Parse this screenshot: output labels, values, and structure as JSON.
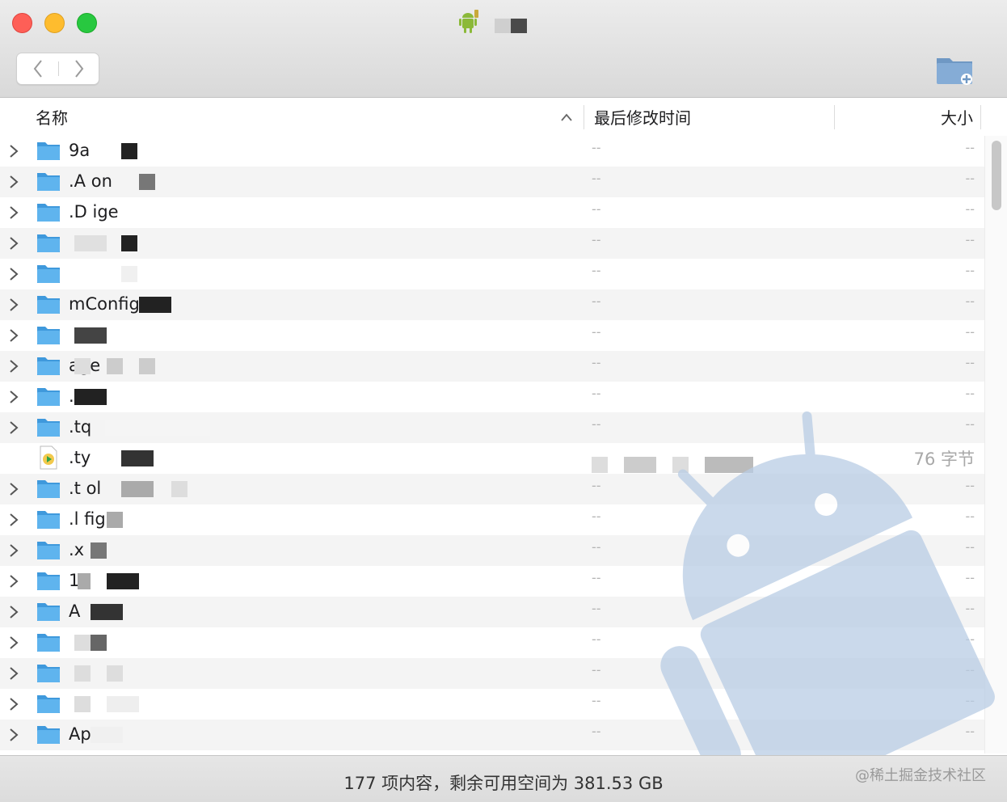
{
  "window": {
    "title": "",
    "app_icon": "android-robot-icon"
  },
  "toolbar": {
    "back_icon": "chevron-left-icon",
    "forward_icon": "chevron-right-icon",
    "new_folder_icon": "folder-plus-icon"
  },
  "columns": {
    "name": "名称",
    "date": "最后修改时间",
    "size": "大小",
    "sort_icon": "chevron-up-icon"
  },
  "rows": [
    {
      "name": "9a",
      "type": "folder",
      "date": "--",
      "size": "--"
    },
    {
      "name": ".A on",
      "type": "folder",
      "date": "--",
      "size": "--"
    },
    {
      "name": ".D ige",
      "type": "folder",
      "date": "--",
      "size": "--"
    },
    {
      "name": "",
      "type": "folder",
      "date": "--",
      "size": "--"
    },
    {
      "name": "",
      "type": "folder",
      "date": "--",
      "size": "--"
    },
    {
      "name": "mConfig",
      "type": "folder",
      "date": "--",
      "size": "--"
    },
    {
      "name": "",
      "type": "folder",
      "date": "--",
      "size": "--"
    },
    {
      "name": "age",
      "type": "folder",
      "date": "--",
      "size": "--"
    },
    {
      "name": ".t",
      "type": "folder",
      "date": "--",
      "size": "--"
    },
    {
      "name": ".tq",
      "type": "folder",
      "date": "--",
      "size": "--"
    },
    {
      "name": ".ty",
      "type": "file",
      "date": "",
      "size": "76 字节"
    },
    {
      "name": ".t ol",
      "type": "folder",
      "date": "--",
      "size": "--"
    },
    {
      "name": ".l fig",
      "type": "folder",
      "date": "--",
      "size": "--"
    },
    {
      "name": ".x",
      "type": "folder",
      "date": "--",
      "size": "--"
    },
    {
      "name": "1",
      "type": "folder",
      "date": "--",
      "size": "--"
    },
    {
      "name": "A",
      "type": "folder",
      "date": "--",
      "size": "--"
    },
    {
      "name": "",
      "type": "folder",
      "date": "--",
      "size": "--"
    },
    {
      "name": "",
      "type": "folder",
      "date": "--",
      "size": "--"
    },
    {
      "name": "",
      "type": "folder",
      "date": "--",
      "size": "--"
    },
    {
      "name": "Ap r",
      "type": "folder",
      "date": "--",
      "size": "--"
    }
  ],
  "status": {
    "summary": "177 项内容，剩余可用空间为 381.53 GB",
    "credit": "@稀土掘金技术社区"
  },
  "colors": {
    "folder": "#5fb4ee",
    "folder_dark": "#3f99dc",
    "watermark": "#b9cde5",
    "close": "#fe5f57",
    "minimize": "#febc2e",
    "zoom": "#28c840"
  }
}
